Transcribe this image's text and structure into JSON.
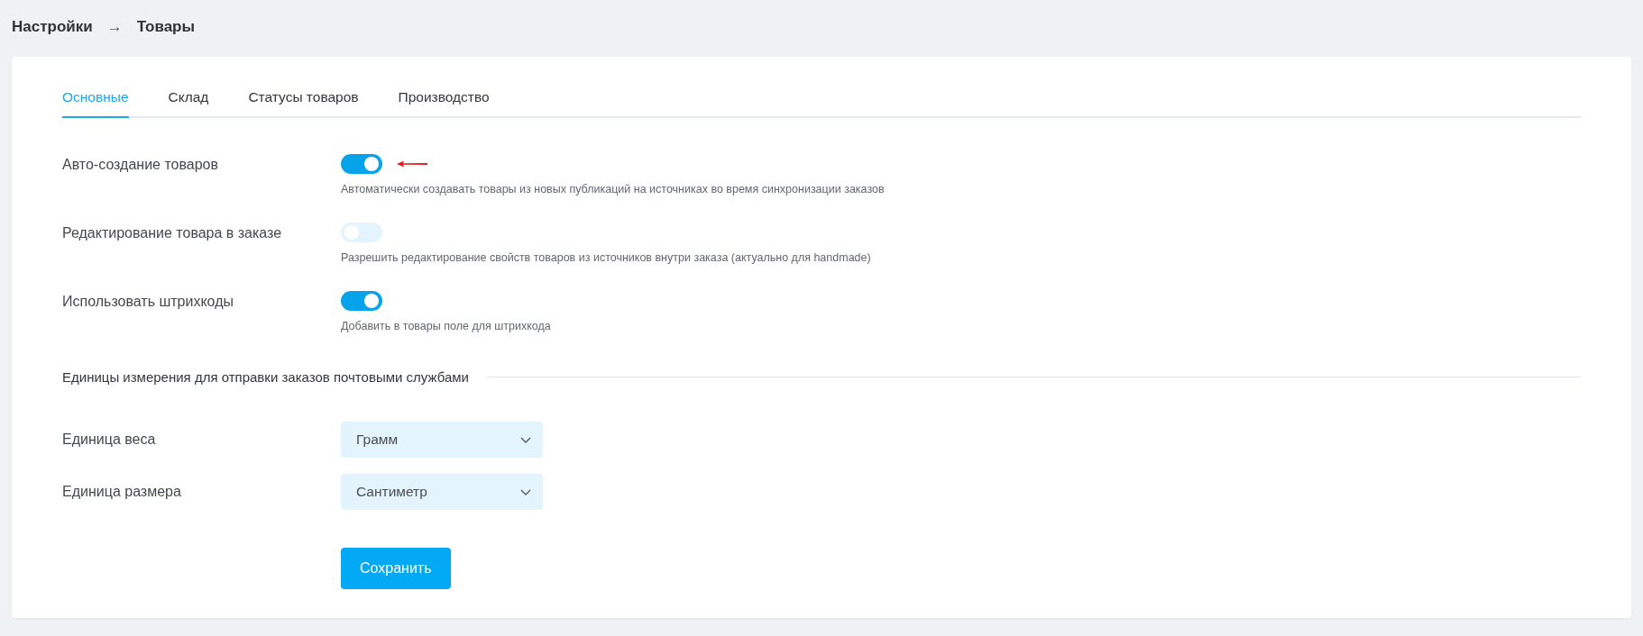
{
  "breadcrumb": {
    "items": [
      "Настройки",
      "Товары"
    ],
    "separator": "→"
  },
  "tabs": [
    {
      "label": "Основные",
      "selected": true
    },
    {
      "label": "Склад",
      "selected": false
    },
    {
      "label": "Статусы товаров",
      "selected": false
    },
    {
      "label": "Производство",
      "selected": false
    }
  ],
  "settings": [
    {
      "label": "Авто-создание товаров",
      "on": true,
      "description": "Автоматически создавать товары из новых публикаций на источниках во время синхронизации заказов",
      "annotated": true
    },
    {
      "label": "Редактирование товара в заказе",
      "on": false,
      "description": "Разрешить редактирование свойств товаров из источников внутри заказа (актуально для handmade)",
      "annotated": false
    },
    {
      "label": "Использовать штрихкоды",
      "on": true,
      "description": "Добавить в товары поле для штрихкода",
      "annotated": false
    }
  ],
  "units_section": {
    "title": "Единицы измерения для отправки заказов почтовыми службами",
    "fields": [
      {
        "label": "Единица веса",
        "value": "Грамм"
      },
      {
        "label": "Единица размера",
        "value": "Сантиметр"
      }
    ]
  },
  "save_button": "Сохранить"
}
